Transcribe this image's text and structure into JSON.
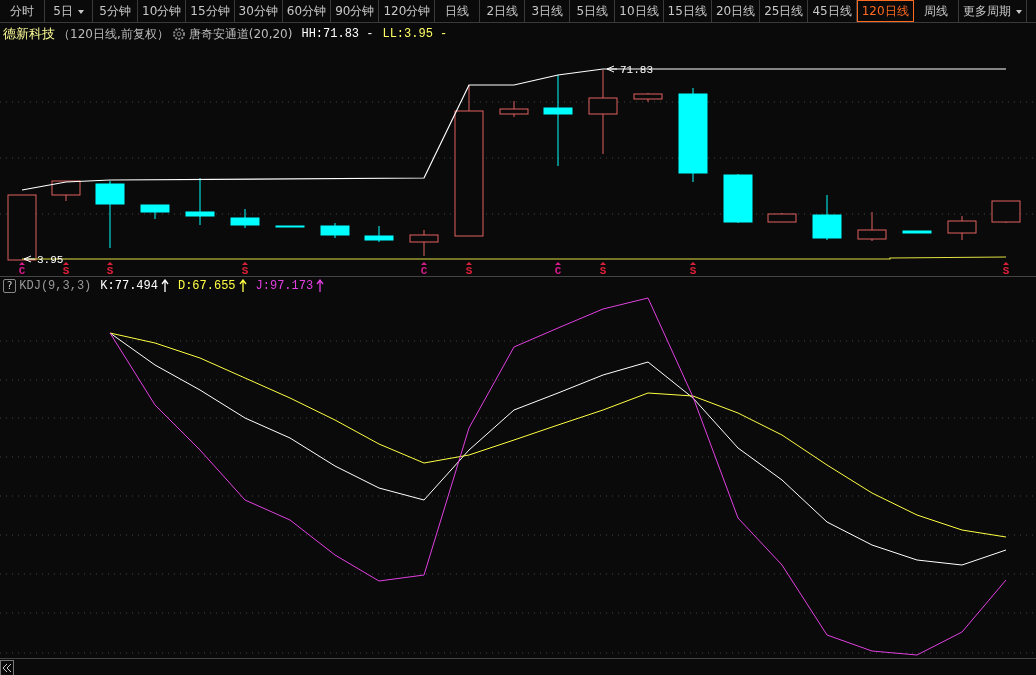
{
  "tabs": [
    {
      "label": "分时",
      "selected": false
    },
    {
      "label": "5日",
      "selected": false,
      "dropdown": true
    },
    {
      "label": "5分钟",
      "selected": false
    },
    {
      "label": "10分钟",
      "selected": false
    },
    {
      "label": "15分钟",
      "selected": false
    },
    {
      "label": "30分钟",
      "selected": false
    },
    {
      "label": "60分钟",
      "selected": false
    },
    {
      "label": "90分钟",
      "selected": false
    },
    {
      "label": "120分钟",
      "selected": false
    },
    {
      "label": "日线",
      "selected": false
    },
    {
      "label": "2日线",
      "selected": false
    },
    {
      "label": "3日线",
      "selected": false
    },
    {
      "label": "5日线",
      "selected": false
    },
    {
      "label": "10日线",
      "selected": false
    },
    {
      "label": "15日线",
      "selected": false
    },
    {
      "label": "20日线",
      "selected": false
    },
    {
      "label": "25日线",
      "selected": false
    },
    {
      "label": "45日线",
      "selected": false
    },
    {
      "label": "120日线",
      "selected": true
    },
    {
      "label": "周线",
      "selected": false
    },
    {
      "label": "更多周期",
      "selected": false,
      "dropdown": true
    }
  ],
  "title_bar": {
    "stock_name": "德新科技",
    "period_note": "（120日线,前复权）",
    "indicator": "唐奇安通道(20,20)",
    "values": [
      {
        "text": "HH:71.83 -",
        "color": "#ffffff"
      },
      {
        "text": "LL:3.95 -",
        "color": "#ffff66"
      }
    ]
  },
  "price_chart": {
    "high_label": "71.83",
    "low_label": "3.95",
    "signals": [
      {
        "label": "C",
        "color": "#d81b8c"
      },
      {
        "label": "S",
        "color": "#e0203a"
      },
      {
        "label": "S",
        "color": "#e0203a"
      },
      {
        "label": "S",
        "color": "#e0203a"
      },
      {
        "label": "C",
        "color": "#d81b8c"
      },
      {
        "label": "S",
        "color": "#e0203a"
      },
      {
        "label": "C",
        "color": "#d81b8c"
      },
      {
        "label": "S",
        "color": "#e0203a"
      },
      {
        "label": "S",
        "color": "#e0203a"
      },
      {
        "label": "S",
        "color": "#e0203a"
      }
    ]
  },
  "kdj": {
    "help": "?",
    "name": "KDJ(9,3,3)",
    "values": [
      {
        "text": "K:77.494",
        "color": "#ffffff"
      },
      {
        "text": "D:67.655",
        "color": "#ffff44"
      },
      {
        "text": "J:97.173",
        "color": "#e040e0"
      }
    ]
  }
}
